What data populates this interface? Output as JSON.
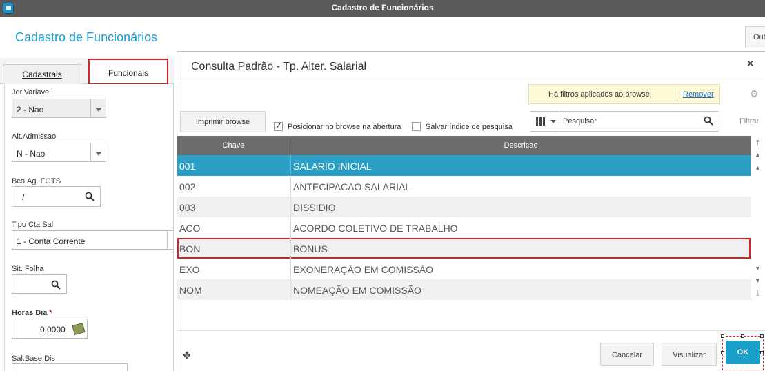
{
  "window": {
    "title": "Cadastro de Funcionários"
  },
  "header": {
    "title": "Cadastro de Funcionários",
    "outros_label": "Out"
  },
  "tabs": [
    {
      "label": "Cadastrais"
    },
    {
      "label": "Funcionais"
    }
  ],
  "form": {
    "jor_variavel": {
      "label": "Jor.Variavel",
      "value": "2 - Nao"
    },
    "alt_admissao": {
      "label": "Alt.Admissao",
      "value": "N - Nao"
    },
    "bco_ag_fgts": {
      "label": "Bco.Ag. FGTS",
      "value": "/"
    },
    "tipo_cta_sal": {
      "label": "Tipo Cta Sal",
      "value": "1 - Conta Corrente"
    },
    "sit_folha": {
      "label": "Sit. Folha",
      "value": ""
    },
    "horas_dia": {
      "label": "Horas Dia",
      "required_mark": "*",
      "value": "0,0000"
    },
    "sal_base_dis": {
      "label": "Sal.Base.Dis",
      "value": ""
    }
  },
  "dialog": {
    "title": "Consulta Padrão - Tp. Alter. Salarial",
    "close_glyph": "×",
    "filter_note": "Há filtros aplicados ao browse",
    "remove_link": "Remover",
    "print_button": "Imprimir browse",
    "checkbox_posicionar": {
      "label": "Posicionar no browse na abertura",
      "checked": true
    },
    "checkbox_salvar": {
      "label": "Salvar índice de pesquisa",
      "checked": false
    },
    "search": {
      "value": "Pesquisar"
    },
    "filter_label": "Filtrar",
    "table": {
      "columns": [
        "Chave",
        "Descricao"
      ],
      "rows": [
        {
          "key": "001",
          "desc": "SALARIO INICIAL"
        },
        {
          "key": "002",
          "desc": "ANTECIPACAO SALARIAL"
        },
        {
          "key": "003",
          "desc": "DISSIDIO"
        },
        {
          "key": "ACO",
          "desc": "ACORDO COLETIVO DE TRABALHO"
        },
        {
          "key": "BON",
          "desc": "BONUS"
        },
        {
          "key": "EXO",
          "desc": "EXONERAÇÃO EM COMISSÃO"
        },
        {
          "key": "NOM",
          "desc": "NOMEAÇÃO EM COMISSÃO"
        }
      ],
      "selected_key": "001",
      "highlighted_key": "BON"
    },
    "footer": {
      "cancel": "Cancelar",
      "view": "Visualizar",
      "ok": "OK"
    }
  },
  "colors": {
    "accent": "#1a9fd3",
    "selected_row": "#2a9ec4",
    "highlight_border": "#d3232b",
    "table_header": "#6b6b6b"
  }
}
